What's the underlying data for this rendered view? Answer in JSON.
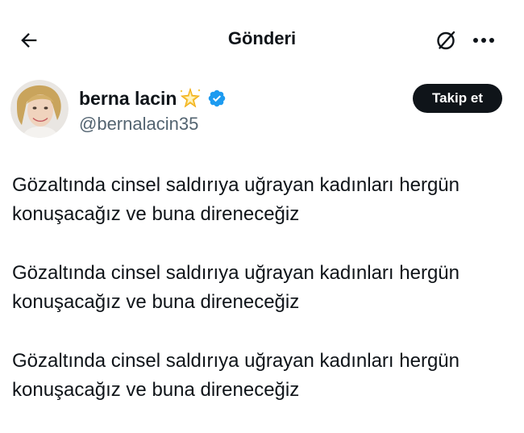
{
  "header": {
    "title": "Gönderi",
    "back_icon": "arrow-left-icon",
    "nosync_icon": "circle-slash-icon",
    "more_icon": "more-dots-icon"
  },
  "author": {
    "name": "berna lacin",
    "emoji": "🌟",
    "handle": "@bernalacin35",
    "verified": true,
    "verified_color": "#1d9bf0"
  },
  "follow_button": {
    "label": "Takip et"
  },
  "tweet": {
    "paragraphs": [
      {
        "line1": "Gözaltında cinsel saldırıya uğrayan kadınları hergün",
        "line2": "konuşacağız ve buna direneceğiz"
      },
      {
        "line1": "Gözaltında cinsel saldırıya uğrayan kadınları hergün",
        "line2": "konuşacağız ve buna direneceğiz"
      },
      {
        "line1": "Gözaltında cinsel saldırıya uğrayan kadınları hergün",
        "line2": "konuşacağız ve buna direneceğiz"
      }
    ]
  },
  "colors": {
    "text": "#0f1419",
    "secondary_text": "#536471",
    "button_bg": "#0f1419",
    "button_text": "#ffffff",
    "background": "#ffffff"
  }
}
